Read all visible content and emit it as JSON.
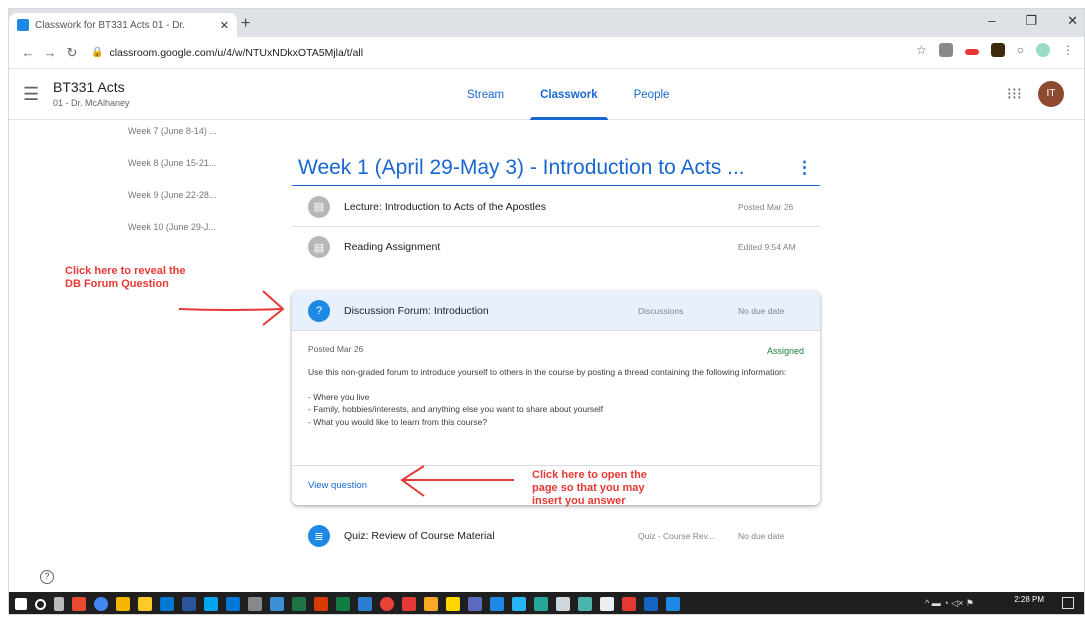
{
  "browser": {
    "tab_title": "Classwork for BT331 Acts 01 - Dr.",
    "url": "classroom.google.com/u/4/w/NTUxNDkxOTA5Mjla/t/all"
  },
  "classroom": {
    "class_name": "BT331 Acts",
    "class_sub": "01 - Dr. McAlhaney",
    "tabs": [
      "Stream",
      "Classwork",
      "People"
    ],
    "active_tab": "Classwork",
    "avatar_initials": "IT"
  },
  "topics": [
    "Week 7 (June 8-14) ...",
    "Week 8 (June 15-21...",
    "Week 9 (June 22-28...",
    "Week 10 (June 29-J..."
  ],
  "week": {
    "title": "Week 1 (April 29-May 3) - Introduction to Acts ...",
    "items": [
      {
        "title": "Lecture: Introduction to Acts of the Apostles",
        "category": "",
        "date": "Posted Mar 26",
        "icon": "material-icon"
      },
      {
        "title": "Reading Assignment",
        "category": "",
        "date": "Edited 9:54 AM",
        "icon": "material-icon"
      }
    ],
    "discussion": {
      "title": "Discussion Forum: Introduction",
      "category": "Discussions",
      "due": "No due date",
      "posted": "Posted Mar 26",
      "status": "Assigned",
      "description": "Use this non-graded forum to introduce yourself to others in the course by posting a thread containing the following information:\n\n- Where you live\n- Family, hobbies/interests, and anything else you want to share about yourself\n- What you would like to learn from this course?",
      "action": "View question",
      "icon": "question-icon"
    },
    "quiz": {
      "title": "Quiz: Review of Course Material",
      "category": "Quiz - Course Rev...",
      "due": "No due date",
      "icon": "assignment-icon"
    }
  },
  "annotations": {
    "reveal": "Click here to reveal the\nDB Forum Question",
    "open": "Click here to open the\npage so that you may\ninsert you answer"
  },
  "taskbar": {
    "time": "2:28 PM"
  },
  "colors": {
    "accent": "#1967d2",
    "annotation": "#e53935",
    "assigned": "#188038"
  }
}
